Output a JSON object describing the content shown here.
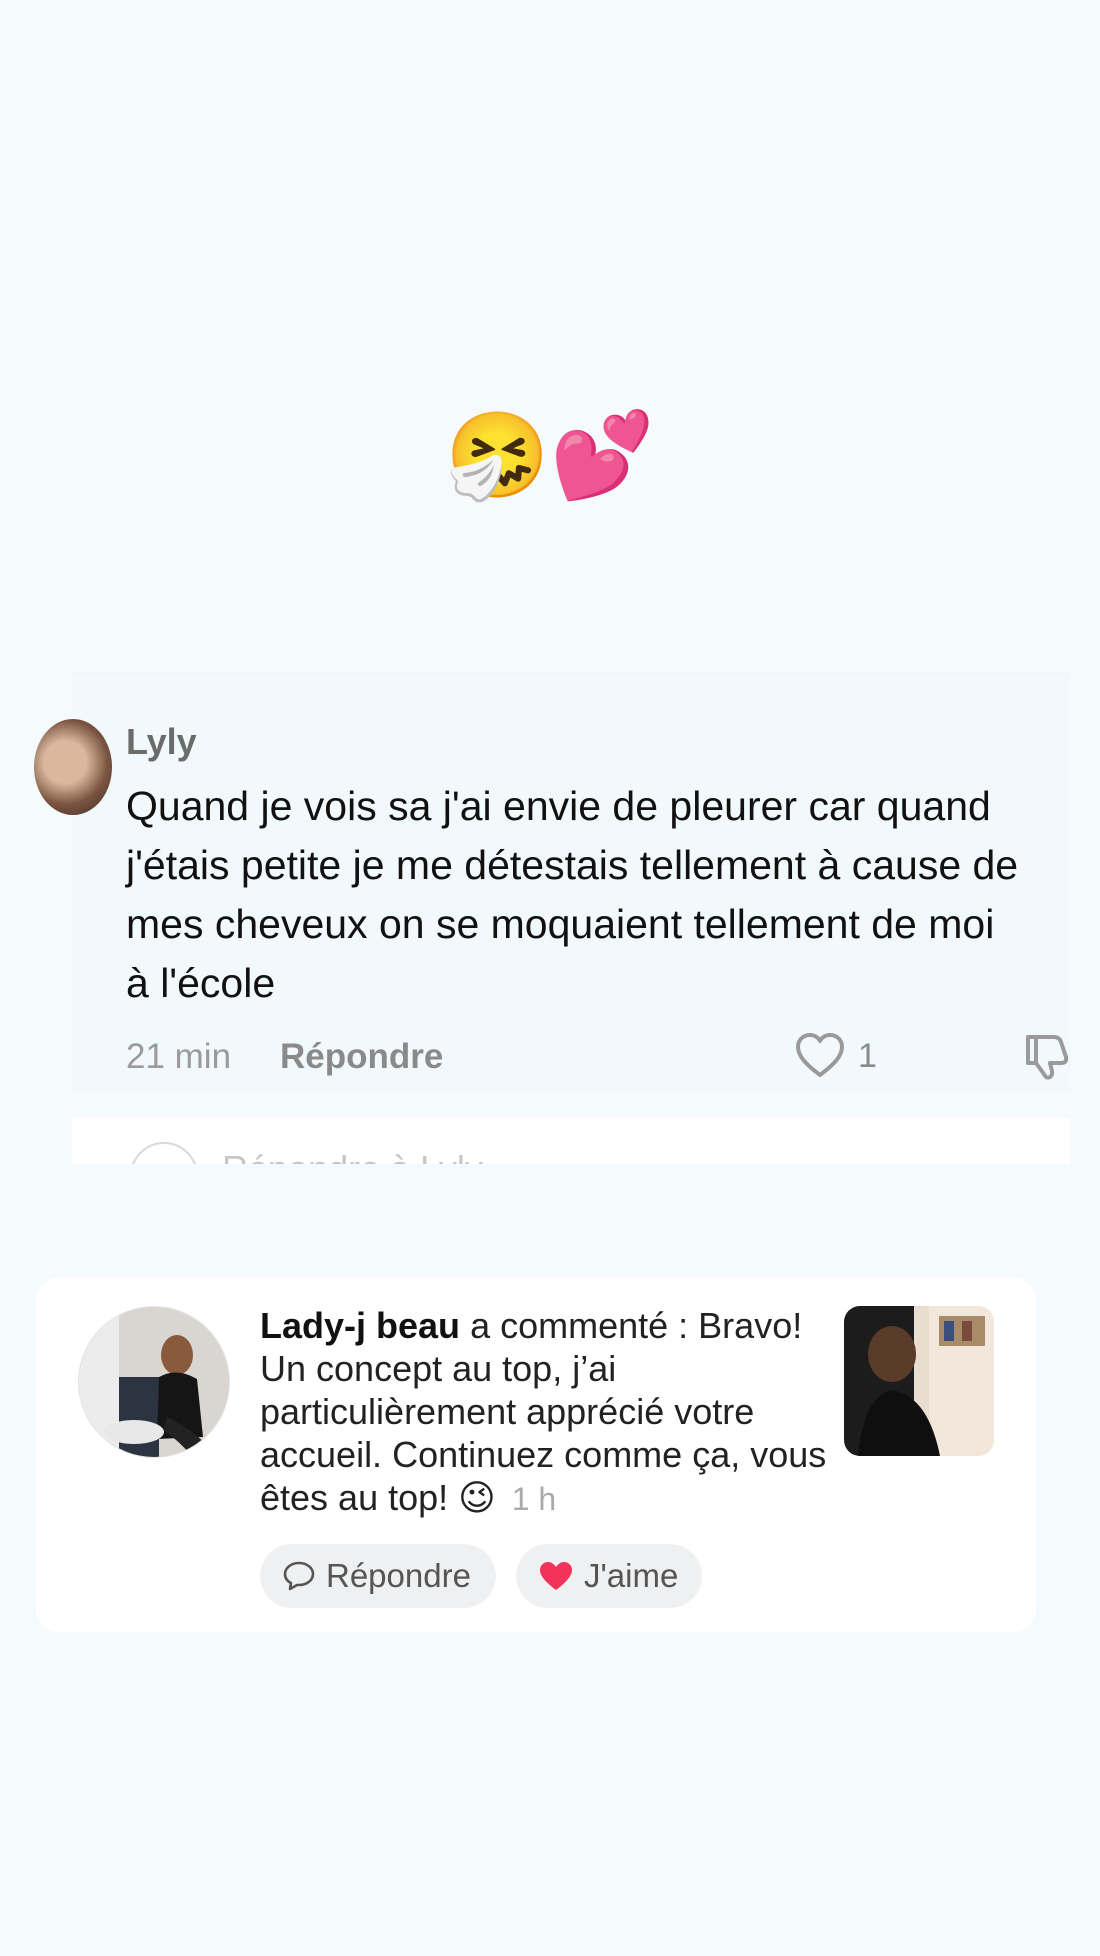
{
  "top_emoji": "🤧💕",
  "comment": {
    "author": "Lyly",
    "text": "Quand je vois sa j'ai envie de pleurer car quand j'étais petite je me détestais tellement à cause de mes cheveux on se moquaient tellement de moi à l'école",
    "time": "21 min",
    "reply_label": "Répondre",
    "like_count": "1",
    "reply_preview": "Répondre à Lyly"
  },
  "notification": {
    "author": "Lady-j beau",
    "action": "a commenté :",
    "text": "Bravo! Un concept au top, j’ai particulièrement apprécié votre accueil. Continuez comme ça, vous êtes au top! 😉",
    "time": "1 h",
    "reply_label": "Répondre",
    "like_label": "J'aime",
    "like_color": "#f2335a"
  }
}
